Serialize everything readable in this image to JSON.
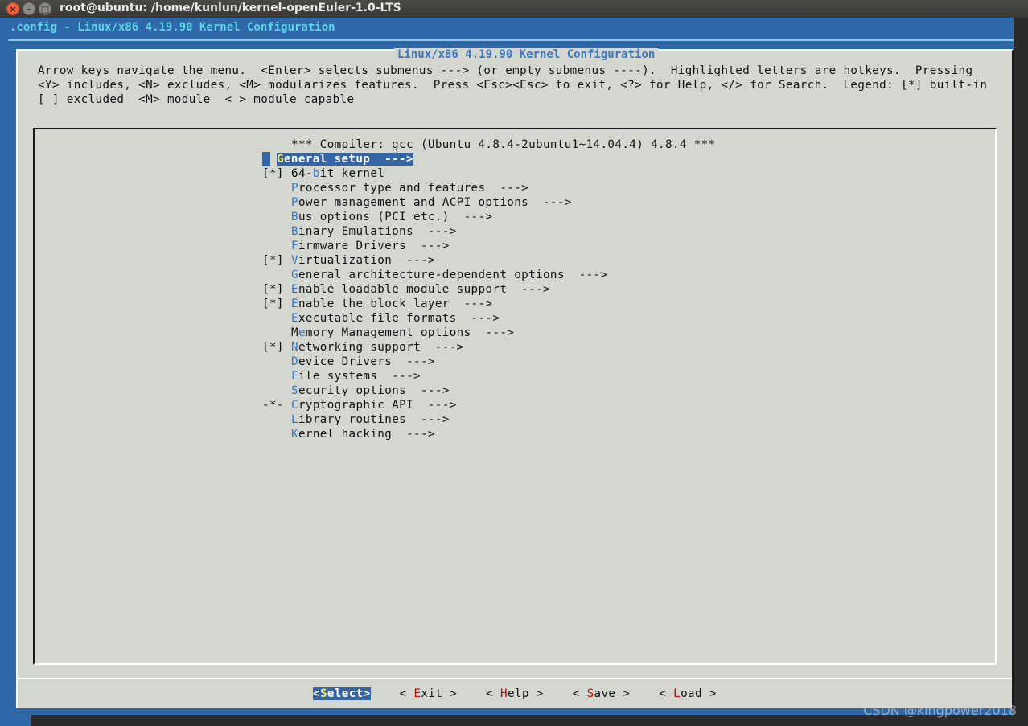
{
  "window": {
    "title": "root@ubuntu: /home/kunlun/kernel-openEuler-1.0-LTS",
    "close_glyph": "×",
    "min_glyph": "–",
    "max_glyph": "□"
  },
  "backtitle": ".config - Linux/x86 4.19.90 Kernel Configuration",
  "dialog": {
    "title": "Linux/x86 4.19.90 Kernel Configuration",
    "help_lines": [
      "Arrow keys navigate the menu.  <Enter> selects submenus ---> (or empty submenus ----).  Highlighted letters are hotkeys.  Pressing",
      "<Y> includes, <N> excludes, <M> modularizes features.  Press <Esc><Esc> to exit, <?> for Help, </> for Search.  Legend: [*] built-in",
      "[ ] excluded  <M> module  < > module capable"
    ]
  },
  "menu": {
    "compiler_line": "*** Compiler: gcc (Ubuntu 4.8.4-2ubuntu1~14.04.4) 4.8.4 ***",
    "items": [
      {
        "prefix": "",
        "pre": "",
        "hot": "G",
        "rest": "eneral setup  --->",
        "selected": true
      },
      {
        "prefix": "[*]",
        "pre": "64-",
        "hot": "b",
        "rest": "it kernel"
      },
      {
        "prefix": "",
        "pre": "",
        "hot": "P",
        "rest": "rocessor type and features  --->"
      },
      {
        "prefix": "",
        "pre": "",
        "hot": "P",
        "rest": "ower management and ACPI options  --->"
      },
      {
        "prefix": "",
        "pre": "",
        "hot": "B",
        "rest": "us options (PCI etc.)  --->"
      },
      {
        "prefix": "",
        "pre": "",
        "hot": "B",
        "rest": "inary Emulations  --->"
      },
      {
        "prefix": "",
        "pre": "",
        "hot": "F",
        "rest": "irmware Drivers  --->"
      },
      {
        "prefix": "[*]",
        "pre": "",
        "hot": "V",
        "rest": "irtualization  --->"
      },
      {
        "prefix": "",
        "pre": "",
        "hot": "G",
        "rest": "eneral architecture-dependent options  --->"
      },
      {
        "prefix": "[*]",
        "pre": "",
        "hot": "E",
        "rest": "nable loadable module support  --->"
      },
      {
        "prefix": "[*]",
        "pre": "",
        "hot": "E",
        "rest": "nable the block layer  --->"
      },
      {
        "prefix": "",
        "pre": "",
        "hot": "E",
        "rest": "xecutable file formats  --->"
      },
      {
        "prefix": "",
        "pre": "M",
        "hot": "e",
        "rest": "mory Management options  --->"
      },
      {
        "prefix": "[*]",
        "pre": "",
        "hot": "N",
        "rest": "etworking support  --->"
      },
      {
        "prefix": "",
        "pre": "",
        "hot": "D",
        "rest": "evice Drivers  --->"
      },
      {
        "prefix": "",
        "pre": "",
        "hot": "F",
        "rest": "ile systems  --->"
      },
      {
        "prefix": "",
        "pre": "",
        "hot": "S",
        "rest": "ecurity options  --->"
      },
      {
        "prefix": "-*-",
        "pre": "",
        "hot": "C",
        "rest": "ryptographic API  --->"
      },
      {
        "prefix": "",
        "pre": "",
        "hot": "L",
        "rest": "ibrary routines  --->"
      },
      {
        "prefix": "",
        "pre": "",
        "hot": "K",
        "rest": "ernel hacking  --->"
      }
    ]
  },
  "buttons": [
    {
      "name": "select-button",
      "pre": "<",
      "hot": "S",
      "rest": "elect>",
      "active": true
    },
    {
      "name": "exit-button",
      "pre": "< ",
      "hot": "E",
      "rest": "xit >"
    },
    {
      "name": "help-button",
      "pre": "< ",
      "hot": "H",
      "rest": "elp >"
    },
    {
      "name": "save-button",
      "pre": "< ",
      "hot": "S",
      "rest": "ave >"
    },
    {
      "name": "load-button",
      "pre": "< ",
      "hot": "L",
      "rest": "oad >"
    }
  ],
  "watermark": "CSDN @kingpower2018",
  "colors": {
    "terminal_bg": "#2f68a8",
    "dialog_bg": "#d3d7cf",
    "selection_bg": "#3465a4",
    "hotkey_blue": "#3b77c2",
    "button_hotkey_red": "#cc0000",
    "selected_hotkey_yellow": "#f6e35b",
    "backtitle_cyan": "#5fd7e8"
  }
}
